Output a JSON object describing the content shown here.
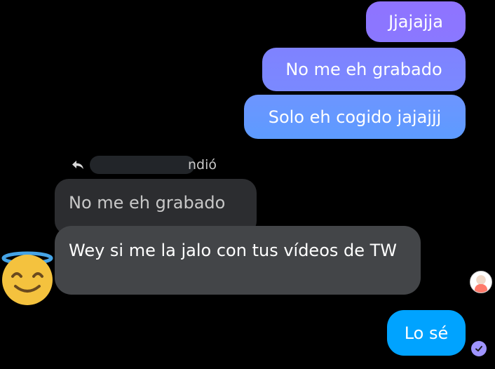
{
  "messages": {
    "sent": [
      {
        "text": "Jjajajja"
      },
      {
        "text": "No me eh grabado"
      },
      {
        "text": "Solo eh cogido jajajjj"
      },
      {
        "text": "Lo sé"
      }
    ],
    "reply": {
      "context_suffix": "ndió",
      "quoted_text": "No me eh grabado",
      "text": "Wey si me la jalo con tus vídeos de TW"
    }
  },
  "colors": {
    "sent_bubble_1": "#8f73ff",
    "sent_bubble_2": "#7f82ff",
    "sent_bubble_3": "#6d95ff",
    "sent_bubble_4": "#00a3ff",
    "received_bubble": "#434548",
    "quoted_bubble": "#2c2d30",
    "background": "#000000"
  },
  "icons": {
    "reply": "reply-arrow-icon",
    "emoji_reaction": "angel-emoji-icon",
    "seen": "check-circle-icon",
    "avatar": "avatar"
  }
}
